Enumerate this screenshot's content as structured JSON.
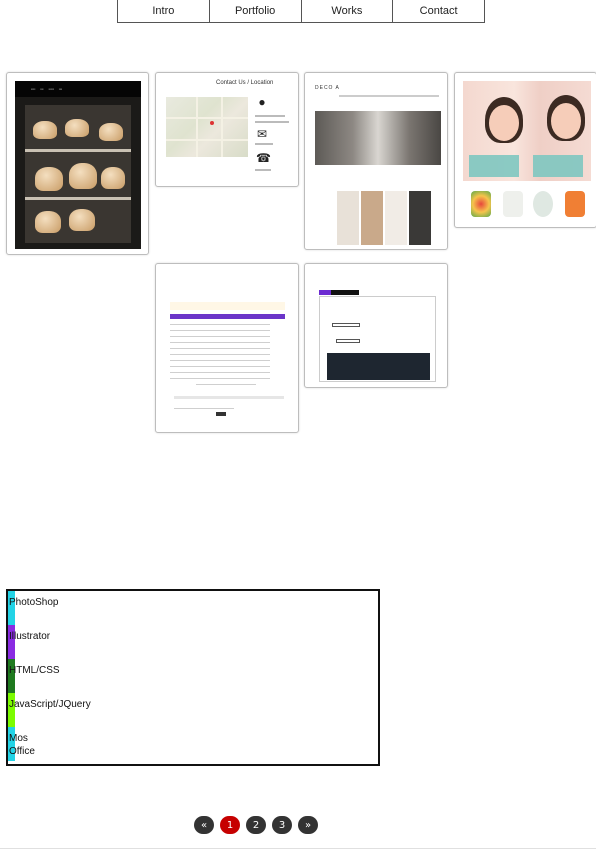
{
  "nav": {
    "items": [
      {
        "label": "Intro"
      },
      {
        "label": "Portfolio"
      },
      {
        "label": "Works"
      },
      {
        "label": "Contact"
      }
    ]
  },
  "gallery": {
    "cards": [
      {
        "name": "bakery-site"
      },
      {
        "name": "contact-location-site",
        "title": "Contact Us / Location"
      },
      {
        "name": "fashion-site",
        "logo": "DECO A"
      },
      {
        "name": "cosmetics-site"
      },
      {
        "name": "board-table-page"
      },
      {
        "name": "login-page"
      }
    ]
  },
  "skills": {
    "items": [
      {
        "label": "PhotoShop",
        "color": "#22d3e6",
        "level": 0.02
      },
      {
        "label": "Illustrator",
        "color": "#8a2be2",
        "level": 0.02
      },
      {
        "label": "HTML/CSS",
        "color": "#1f7a1f",
        "level": 0.02
      },
      {
        "label": "JavaScript/JQuery",
        "color": "#7cfc00",
        "level": 0.02
      },
      {
        "label": "Mos Office",
        "color": "#22d3e6",
        "level": 0.02
      }
    ]
  },
  "pagination": {
    "prev": "«",
    "pages": [
      "1",
      "2",
      "3"
    ],
    "current": "1",
    "next": "»"
  }
}
